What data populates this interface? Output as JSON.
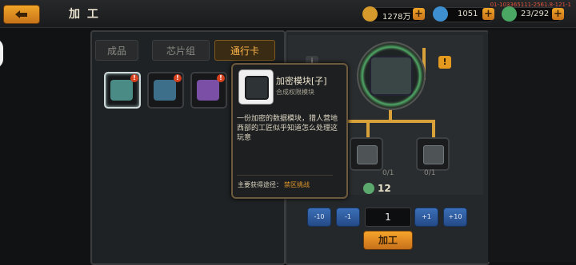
{
  "header": {
    "title": "加 工",
    "version": "01-103365111-2561.8-121-1"
  },
  "resources": [
    {
      "value": "1278万",
      "icon": "gold-coin-icon",
      "color": "#d69a2c"
    },
    {
      "value": "1051",
      "icon": "blue-crystal-icon",
      "color": "#3d8fd0"
    },
    {
      "value": "23/292",
      "icon": "green-energy-icon",
      "color": "#4aa864"
    }
  ],
  "tabs": [
    {
      "label": "成品",
      "active": false
    },
    {
      "label": "芯片组",
      "active": false
    },
    {
      "label": "通行卡",
      "active": true
    }
  ],
  "slots": [
    {
      "color": "#4a8b86",
      "badge": "!"
    },
    {
      "color": "#3e6f8a",
      "badge": "!"
    },
    {
      "color": "#7c4fa6",
      "badge": "!"
    }
  ],
  "recipe": {
    "parts": [
      {
        "count": "0/1"
      },
      {
        "count": "0/1"
      },
      {
        "count": "0/1"
      }
    ],
    "key_count": "12"
  },
  "controls": {
    "minus10": "-10",
    "minus1": "-1",
    "quantity": "1",
    "plus1": "+1",
    "plus10": "+10",
    "process_label": "加工"
  },
  "tooltip": {
    "name": "加密模块[子]",
    "type": "合成权限模块",
    "description": "一份加密的数据模块，猎人营地西部的工匠似乎知道怎么处理这玩意",
    "source_label": "主要获得途径：",
    "source_value": "禁区挑战"
  }
}
